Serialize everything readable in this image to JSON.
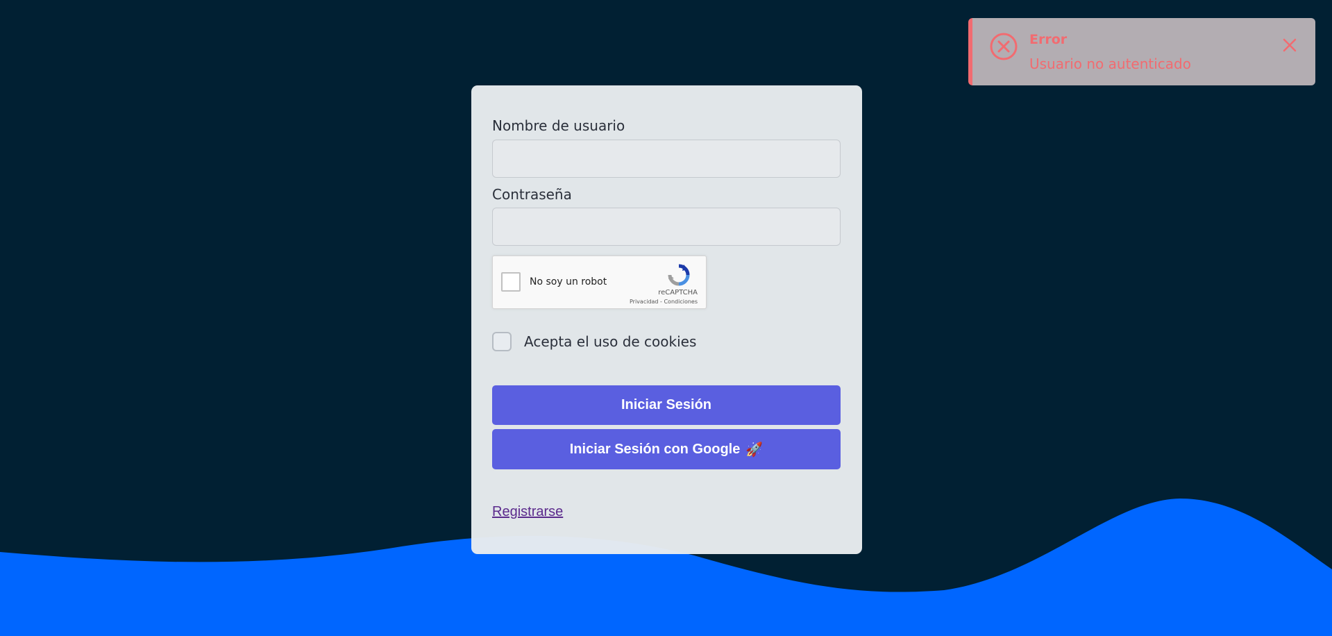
{
  "form": {
    "username_label": "Nombre de usuario",
    "username_value": "",
    "password_label": "Contraseña",
    "password_value": "",
    "captcha": {
      "label": "No soy un robot",
      "brand": "reCAPTCHA",
      "links": "Privacidad - Condiciones",
      "checked": false
    },
    "cookies_label": "Acepta el uso de cookies",
    "cookies_checked": false,
    "login_button": "Iniciar Sesión",
    "google_button": "Iniciar Sesión con Google",
    "google_button_icon": "rocket-icon",
    "register_link": "Registrarse"
  },
  "toast": {
    "title": "Error",
    "message": "Usuario no autenticado",
    "icon": "error-circle-icon",
    "close_icon": "close-icon"
  },
  "colors": {
    "background": "#012033",
    "wave": "#0066ff",
    "card": "#e8ecf0",
    "button": "#5a5fe0",
    "toast_bg": "#b3adb2",
    "error": "#f26b70",
    "link": "#5b2a8c"
  }
}
